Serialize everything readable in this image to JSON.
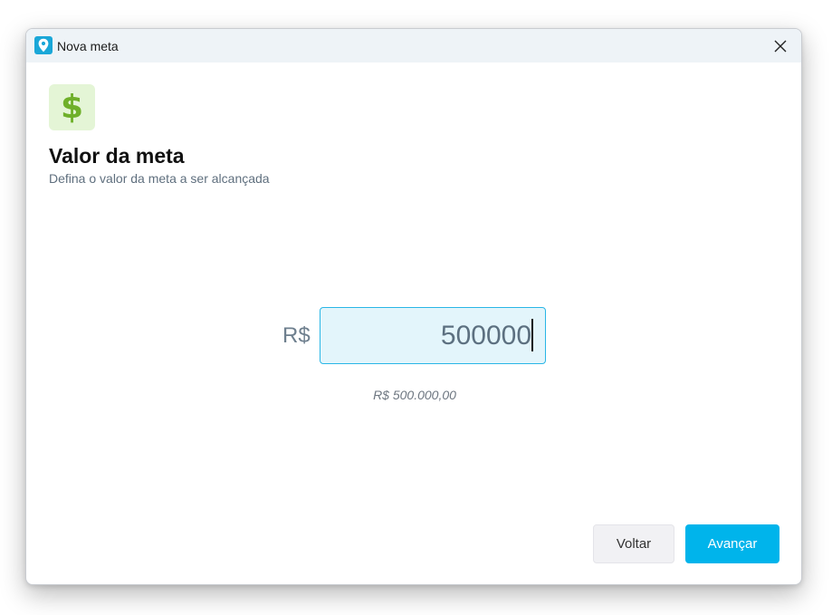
{
  "window": {
    "title": "Nova meta",
    "app_icon": "map-pin-icon",
    "close_icon": "close-icon"
  },
  "goal": {
    "icon": "dollar-sign-icon",
    "icon_glyph": "$",
    "title": "Valor da meta",
    "subtitle": "Defina o valor da meta a ser alcançada"
  },
  "amount": {
    "currency_label": "R$",
    "value": "500000",
    "formatted": "R$ 500.000,00"
  },
  "buttons": {
    "back_label": "Voltar",
    "next_label": "Avançar"
  },
  "colors": {
    "accent": "#00b4eb",
    "app_icon_bg": "#1aa7d8",
    "input_bg": "#e3f5fb",
    "input_border": "#29b6e6",
    "goal_icon_bg": "#e4f5d6",
    "goal_icon_fg": "#6fb02a"
  }
}
